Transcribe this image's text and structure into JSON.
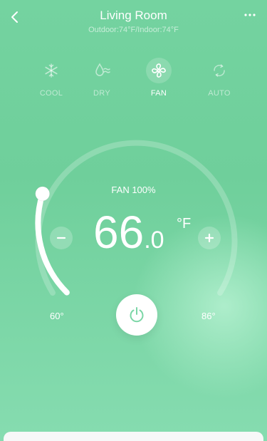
{
  "header": {
    "title": "Living Room",
    "subtitle": "Outdoor:74°F/Indoor:74°F"
  },
  "modes": [
    {
      "label": "COOL",
      "icon": "snowflake-icon",
      "active": false
    },
    {
      "label": "DRY",
      "icon": "water-drop-icon",
      "active": false
    },
    {
      "label": "FAN",
      "icon": "fan-icon",
      "active": true
    },
    {
      "label": "AUTO",
      "icon": "auto-cycle-icon",
      "active": false
    }
  ],
  "thermostat": {
    "fan_label": "FAN 100%",
    "temp_whole": "66",
    "temp_decimal": ".0",
    "unit": "°F",
    "min_label": "60°",
    "max_label": "86°",
    "setpoint": 66,
    "min": 60,
    "max": 86
  },
  "colors": {
    "background": "#74d3a0",
    "accent": "#ffffff",
    "power_icon": "#7bd6a6"
  }
}
